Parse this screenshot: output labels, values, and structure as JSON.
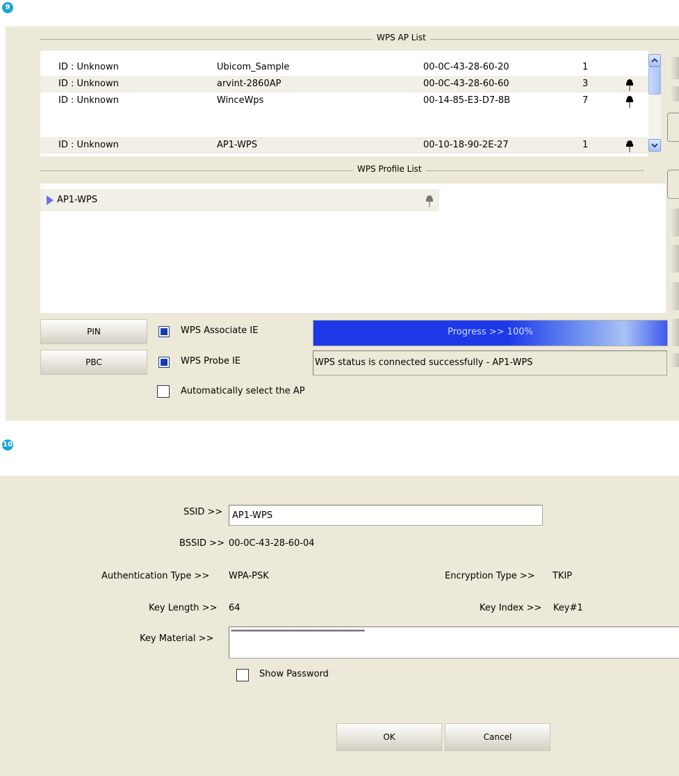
{
  "steps": {
    "first": "9",
    "second": "10"
  },
  "wps_panel": {
    "ap_list_title": "WPS AP List",
    "profile_list_title": "WPS Profile List",
    "ap_rows": [
      {
        "id": "ID : Unknown",
        "ssid": "Ubicom_Sample",
        "bssid": "00-0C-43-28-60-20",
        "channel": "1",
        "secured": false
      },
      {
        "id": "ID : Unknown",
        "ssid": "arvint-2860AP",
        "bssid": "00-0C-43-28-60-60",
        "channel": "3",
        "secured": true
      },
      {
        "id": "ID : Unknown",
        "ssid": "WinceWps",
        "bssid": "00-14-85-E3-D7-8B",
        "channel": "7",
        "secured": true
      },
      {
        "id": "ID : Unknown",
        "ssid": "AP1-WPS",
        "bssid": "00-10-18-90-2E-27",
        "channel": "1",
        "secured": true
      }
    ],
    "profiles": [
      {
        "name": "AP1-WPS",
        "secured": true
      }
    ],
    "pin_button": "PIN",
    "pbc_button": "PBC",
    "associate_ie_label": "WPS Associate IE",
    "probe_ie_label": "WPS Probe IE",
    "auto_select_label": "Automatically select the AP",
    "associate_ie_checked": true,
    "probe_ie_checked": true,
    "auto_select_checked": false,
    "progress_text": "Progress >> 100%",
    "progress_value": 1.0,
    "status_text": "WPS status is connected successfully - AP1-WPS"
  },
  "profile_dialog": {
    "ssid_label": "SSID >>",
    "ssid_value": "AP1-WPS",
    "bssid_label": "BSSID >>",
    "bssid_value": "00-0C-43-28-60-04",
    "auth_label": "Authentication Type >>",
    "auth_value": "WPA-PSK",
    "enc_label": "Encryption Type >>",
    "enc_value": "TKIP",
    "key_length_label": "Key Length >>",
    "key_length_value": "64",
    "key_index_label": "Key Index >>",
    "key_index_value": "Key#1",
    "key_material_label": "Key Material >>",
    "key_material_value": "****************************************************************",
    "show_password_label": "Show Password",
    "show_password_checked": false,
    "ok_button": "OK",
    "cancel_button": "Cancel"
  },
  "colors": {
    "panel_bg": "#ece9d8",
    "progress_start": "#1d39e8",
    "progress_end": "#a9c2f5",
    "badge": "#1aa5d6"
  },
  "icons": {
    "secured": "key-lock-icon",
    "profile_marker": "triangle-right-icon",
    "scroll_up": "chevron-up-icon",
    "scroll_down": "chevron-down-icon"
  }
}
